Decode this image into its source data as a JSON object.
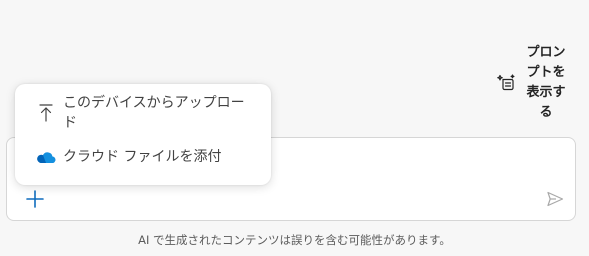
{
  "prompts_button": {
    "label": "プロンプトを表示する",
    "icon": "prompt-sparkle-icon"
  },
  "attach_menu": {
    "items": [
      {
        "label": "このデバイスからアップロード",
        "icon": "upload-icon"
      },
      {
        "label": "クラウド ファイルを添付",
        "icon": "cloud-icon"
      }
    ]
  },
  "composer": {
    "add_icon": "plus-icon",
    "send_icon": "send-icon"
  },
  "footer": {
    "disclaimer": "AI で生成されたコンテンツは誤りを含む可能性があります。"
  },
  "colors": {
    "accent": "#0f6cbd",
    "cloud": "#0078d4",
    "send_disabled": "#bdbdbd"
  }
}
